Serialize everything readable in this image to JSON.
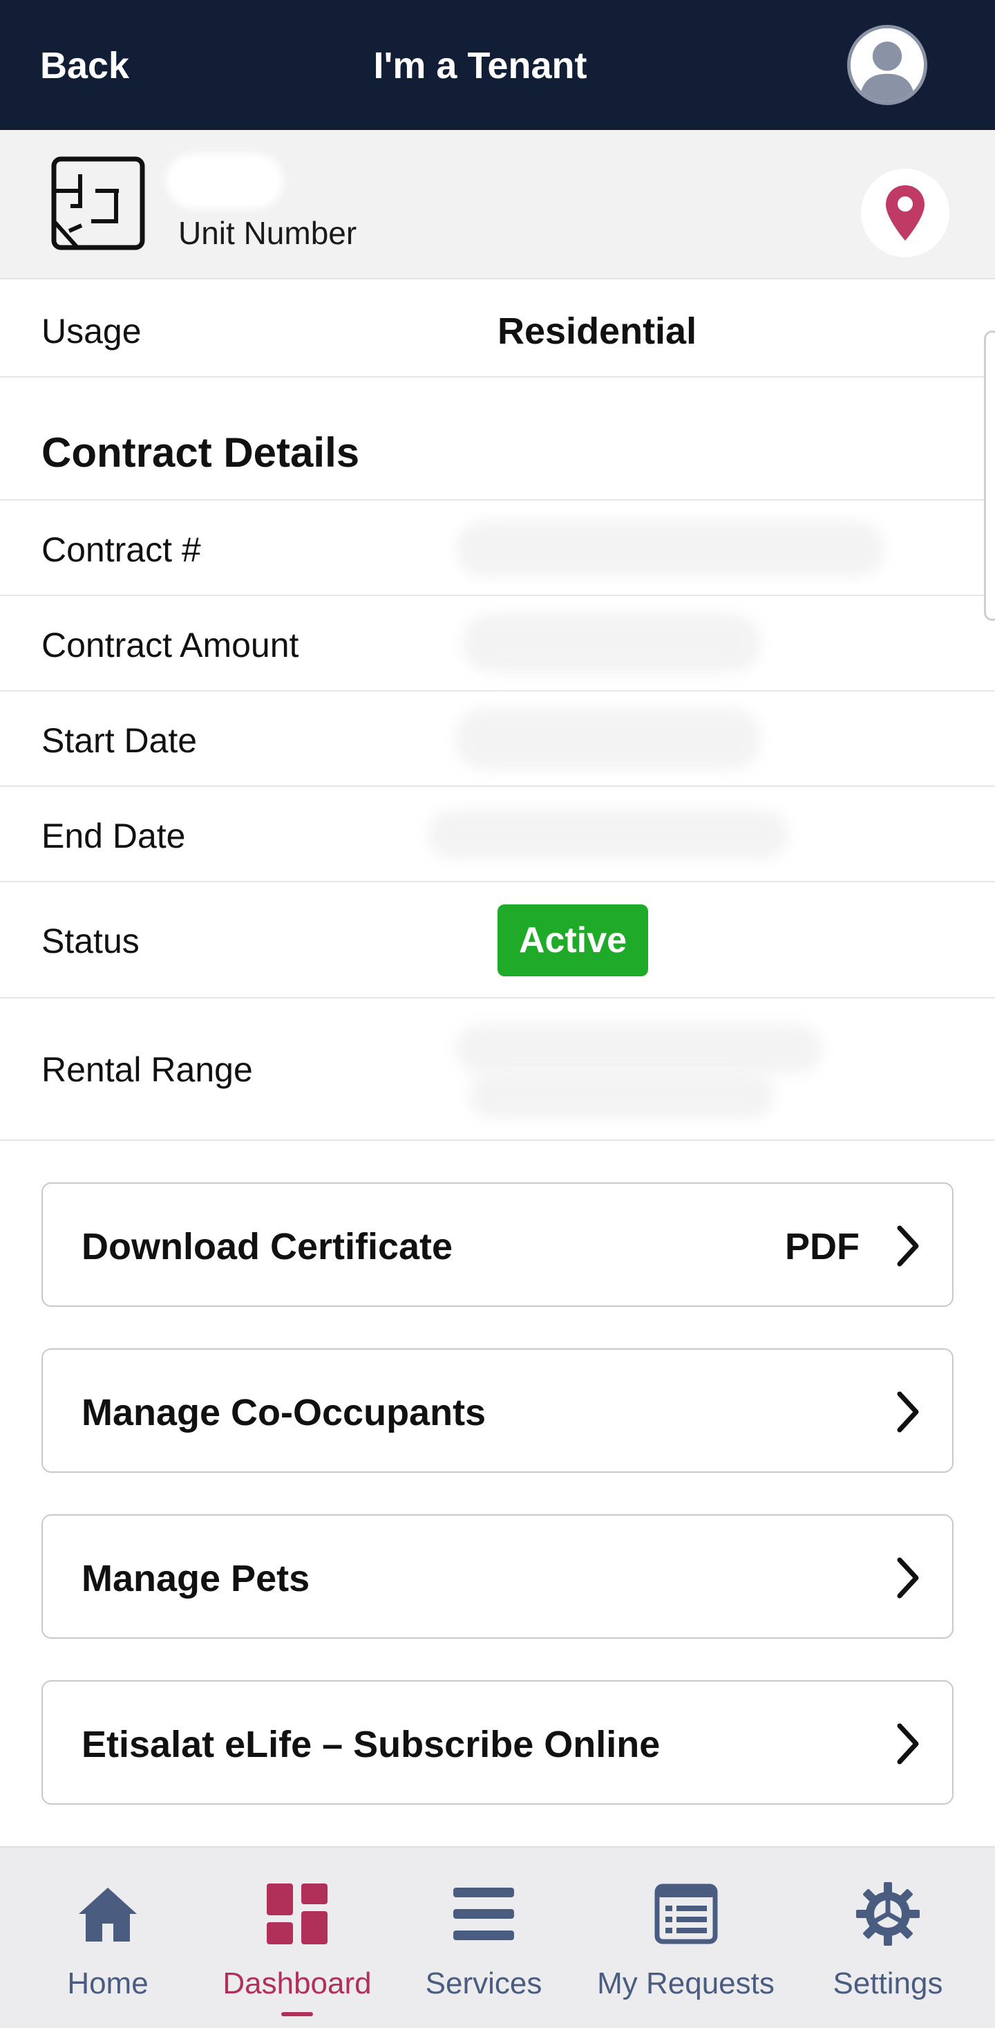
{
  "header": {
    "back_label": "Back",
    "title": "I'm a Tenant",
    "profile_icon": "user-icon"
  },
  "unit": {
    "label": "Unit Number",
    "floorplan_icon": "floorplan-icon",
    "location_icon": "map-pin-icon"
  },
  "details": {
    "usage_label": "Usage",
    "usage_value": "Residential"
  },
  "contract": {
    "section_title": "Contract Details",
    "rows": [
      {
        "label": "Contract #"
      },
      {
        "label": "Contract Amount"
      },
      {
        "label": "Start Date"
      },
      {
        "label": "End Date"
      }
    ],
    "status_label": "Status",
    "status_value": "Active",
    "rental_range_label": "Rental Range"
  },
  "actions": [
    {
      "label": "Download Certificate",
      "right_text": "PDF"
    },
    {
      "label": "Manage Co-Occupants"
    },
    {
      "label": "Manage Pets"
    },
    {
      "label": "Etisalat eLife – Subscribe Online"
    }
  ],
  "tabs": [
    {
      "label": "Home",
      "icon": "home-icon"
    },
    {
      "label": "Dashboard",
      "icon": "dashboard-icon",
      "active": true
    },
    {
      "label": "Services",
      "icon": "menu-icon"
    },
    {
      "label": "My Requests",
      "icon": "list-icon"
    },
    {
      "label": "Settings",
      "icon": "gear-icon"
    }
  ],
  "colors": {
    "header_bg": "#111e36",
    "accent": "#b0305a",
    "status_active": "#1faa2a",
    "tab_inactive": "#4a5d80"
  }
}
